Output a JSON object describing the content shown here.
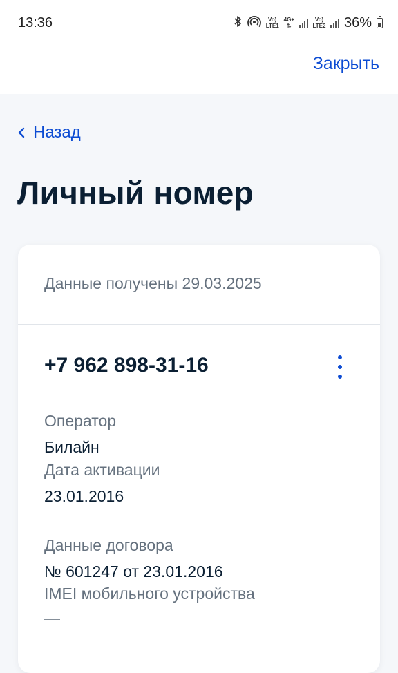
{
  "status_bar": {
    "time": "13:36",
    "vo_lte1_top": "Vo)",
    "vo_lte1_bottom": "LTE1",
    "net_4g": "4G+",
    "vo_lte2_top": "Vo)",
    "vo_lte2_bottom": "LTE2",
    "battery": "36%",
    "icons": [
      "bluetooth-icon",
      "hotspot-icon",
      "signal-icon",
      "battery-icon"
    ]
  },
  "header": {
    "close_label": "Закрыть"
  },
  "nav": {
    "back_label": "Назад"
  },
  "page": {
    "title": "Личный номер"
  },
  "card": {
    "received": "Данные получены 29.03.2025",
    "phone": "+7 962 898-31-16",
    "fields": [
      {
        "label": "Оператор",
        "value": "Билайн"
      },
      {
        "label": "Дата активации",
        "value": "23.01.2016"
      },
      {
        "label": "Данные договора",
        "value": "№ 601247 от 23.01.2016"
      },
      {
        "label": "IMEI мобильного устройства",
        "value": "—"
      }
    ]
  },
  "colors": {
    "accent": "#0d4cd3",
    "text": "#0b1f33",
    "muted": "#66727f",
    "background": "#f5f7fa"
  }
}
